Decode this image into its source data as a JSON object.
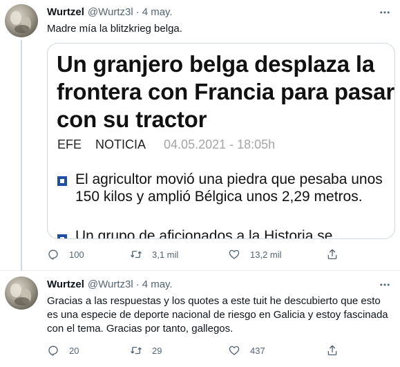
{
  "tweets": [
    {
      "name": "Wurtzel",
      "handle": "@Wurtz3l",
      "separator": "·",
      "date": "4 may.",
      "text": "Madre mía la blitzkrieg belga.",
      "media": {
        "headline": "Un granjero belga desplaza la frontera con Francia para pasar con su tractor",
        "source": "EFE",
        "category": "NOTICIA",
        "timestamp": "04.05.2021 - 18:05h",
        "paragraphs": [
          "El agricultor movió una piedra que pesaba unos 150 kilos y amplió Bélgica unos 2,29 metros.",
          "Un grupo de aficionados a la Historia se"
        ]
      },
      "stats": {
        "replies": "100",
        "retweets": "3,1 mil",
        "likes": "13,2 mil"
      }
    },
    {
      "name": "Wurtzel",
      "handle": "@Wurtz3l",
      "separator": "·",
      "date": "4 may.",
      "text": "Gracias a las respuestas y los quotes a este tuit he descubierto que esto es una especie de deporte nacional de riesgo en Galicia y estoy fascinada con el tema. Gracias por tanto, gallegos.",
      "stats": {
        "replies": "20",
        "retweets": "29",
        "likes": "437"
      }
    }
  ],
  "icons": {
    "reply": "reply-icon",
    "retweet": "retweet-icon",
    "like": "heart-icon",
    "share": "share-icon",
    "more": "more-icon"
  },
  "colors": {
    "secondary_text": "#536471",
    "bullet": "#1d4ea8",
    "border": "#cfd9de"
  }
}
